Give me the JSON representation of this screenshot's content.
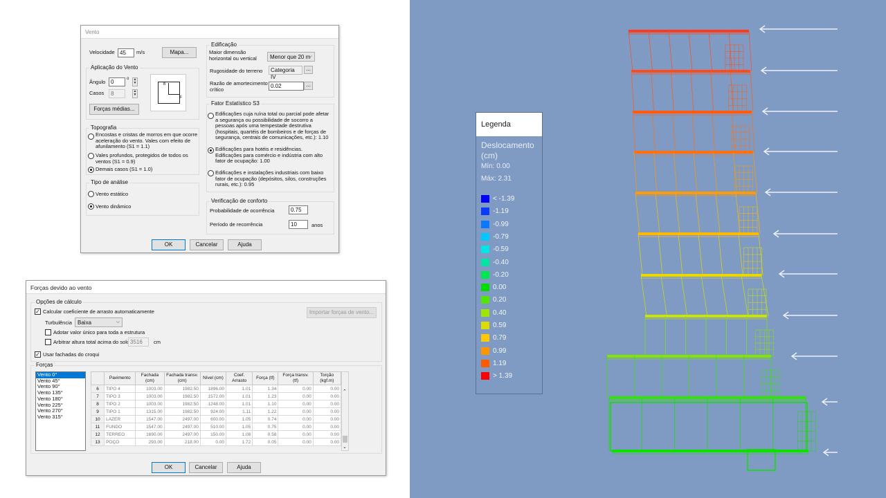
{
  "vento": {
    "title": "Vento",
    "velocidade_label": "Velocidade",
    "velocidade_value": "45",
    "velocidade_unit": "m/s",
    "mapa_button": "Mapa...",
    "aplicacao_group": "Aplicação do Vento",
    "angulo_label": "Ângulo",
    "angulo_value": "0",
    "angulo_unit": "o",
    "casos_label": "Casos",
    "casos_value": "8",
    "forcas_medias_button": "Forças médias...",
    "axis_x": "F",
    "axis_y": "B",
    "topografia_group": "Topografia",
    "topografia_opts": [
      "Encostas e cristas de morros em que ocorre aceleração do vento. Vales com efeito de afunilamento (S1 = 1.1)",
      "Vales profundos, protegidos de todos os ventos (S1 = 0.9)",
      "Demais casos (S1 = 1.0)"
    ],
    "analise_group": "Tipo de análise",
    "analise_opts": [
      "Vento estático",
      "Vento dinâmico"
    ],
    "edificacao_group": "Edificação",
    "maior_dim_label": "Maior dimensão horizontal ou vertical",
    "maior_dim_value": "Menor que 20 m",
    "rugosidade_label": "Rugosidade do terreno",
    "rugosidade_value": "Categoria IV",
    "amortecimento_label": "Razão de amortecimento crítico",
    "amortecimento_value": "0.02",
    "ellipsis": "...",
    "s3_group": "Fator Estatístico S3",
    "s3_opts": [
      "Edificações cuja ruína total ou parcial pode afetar a segurança ou possibilidade de socorro a pessoas após uma tempestade destrutiva (hospitais, quartéis de bombeiros e de forças de segurança, centrais de comunicações, etc.): 1.10",
      "Edificações para hotéis e residências. Edificações para comércio e indústria com alto fator de ocupação: 1.00",
      "Edificações e instalações industriais com baixo fator de ocupação (depósitos, silos, construções rurais, etc.): 0.95"
    ],
    "conforto_group": "Verificação de conforto",
    "probabilidade_label": "Probabilidade de ocorrência",
    "probabilidade_value": "0.75",
    "periodo_label": "Período de recorrência",
    "periodo_value": "10",
    "periodo_unit": "anos",
    "ok": "OK",
    "cancelar": "Cancelar",
    "ajuda": "Ajuda"
  },
  "forcas": {
    "title": "Forças devido ao vento",
    "opcoes_group": "Opções de cálculo",
    "calcular_label": "Calcular coeficiente de arrasto automaticamente",
    "importar_button": "Importar forças de vento...",
    "turbulencia_label": "Turbulência",
    "turbulencia_value": "Baixa",
    "adotar_label": "Adotar valor único para toda a estrutura",
    "arbitrar_label": "Arbitrar altura total acima do solo",
    "arbitrar_value": "3516",
    "arbitrar_unit": "cm",
    "usar_fachadas_label": "Usar fachadas do croqui",
    "forcas_group": "Forças",
    "list": [
      "Vento 0°",
      "Vento 45°",
      "Vento 90°",
      "Vento 135°",
      "Vento 180°",
      "Vento 225°",
      "Vento 270°",
      "Vento 315°"
    ],
    "headers": [
      "",
      "Pavimento",
      "Fachada (cm)",
      "Fachada transv. (cm)",
      "Nível (cm)",
      "Coef. Arrasto",
      "Força (tf)",
      "Força transv. (tf)",
      "Torção (kgf.m)"
    ],
    "rows": [
      [
        "6",
        "TIPO 4",
        "1003.00",
        "1982.50",
        "1896.00",
        "1.01",
        "1.34",
        "0.00",
        "0.00"
      ],
      [
        "7",
        "TIPO 3",
        "1003.00",
        "1982.50",
        "1572.00",
        "1.01",
        "1.23",
        "0.00",
        "0.00"
      ],
      [
        "8",
        "TIPO 2",
        "1003.00",
        "1982.50",
        "1248.00",
        "1.01",
        "1.10",
        "0.00",
        "0.00"
      ],
      [
        "9",
        "TIPO 1",
        "1315.00",
        "1982.50",
        "924.00",
        "1.11",
        "1.22",
        "0.00",
        "0.00"
      ],
      [
        "10",
        "LAZER",
        "1547.00",
        "2497.00",
        "600.00",
        "1.05",
        "0.74",
        "0.00",
        "0.00"
      ],
      [
        "11",
        "FUNDO",
        "1547.00",
        "2497.00",
        "510.00",
        "1.05",
        "0.75",
        "0.00",
        "0.00"
      ],
      [
        "12",
        "TERREO",
        "1690.00",
        "2497.00",
        "150.00",
        "1.08",
        "0.58",
        "0.00",
        "0.00"
      ],
      [
        "13",
        "POÇO",
        "293.00",
        "218.00",
        "0.00",
        "1.72",
        "0.05",
        "0.00",
        "0.00"
      ]
    ],
    "ok": "OK",
    "cancelar": "Cancelar",
    "ajuda": "Ajuda"
  },
  "legend": {
    "header": "Legenda",
    "title": "Deslocamento (cm)",
    "min": "Mín: 0.00",
    "max": "Máx: 2.31",
    "items": [
      {
        "label": "< -1.39",
        "color": "#0000ff"
      },
      {
        "label": "-1.19",
        "color": "#0a3cff"
      },
      {
        "label": "-0.99",
        "color": "#0a78ff"
      },
      {
        "label": "-0.79",
        "color": "#00c8ff"
      },
      {
        "label": "-0.59",
        "color": "#00e6e6"
      },
      {
        "label": "-0.40",
        "color": "#00e6a0"
      },
      {
        "label": "-0.20",
        "color": "#00e650"
      },
      {
        "label": "0.00",
        "color": "#00dc00"
      },
      {
        "label": "0.20",
        "color": "#50e600"
      },
      {
        "label": "0.40",
        "color": "#a0e600"
      },
      {
        "label": "0.59",
        "color": "#dcdc00"
      },
      {
        "label": "0.79",
        "color": "#ffc800"
      },
      {
        "label": "0.99",
        "color": "#ff9600"
      },
      {
        "label": "1.19",
        "color": "#ff5a00"
      },
      {
        "label": "> 1.39",
        "color": "#ff0000"
      }
    ]
  }
}
